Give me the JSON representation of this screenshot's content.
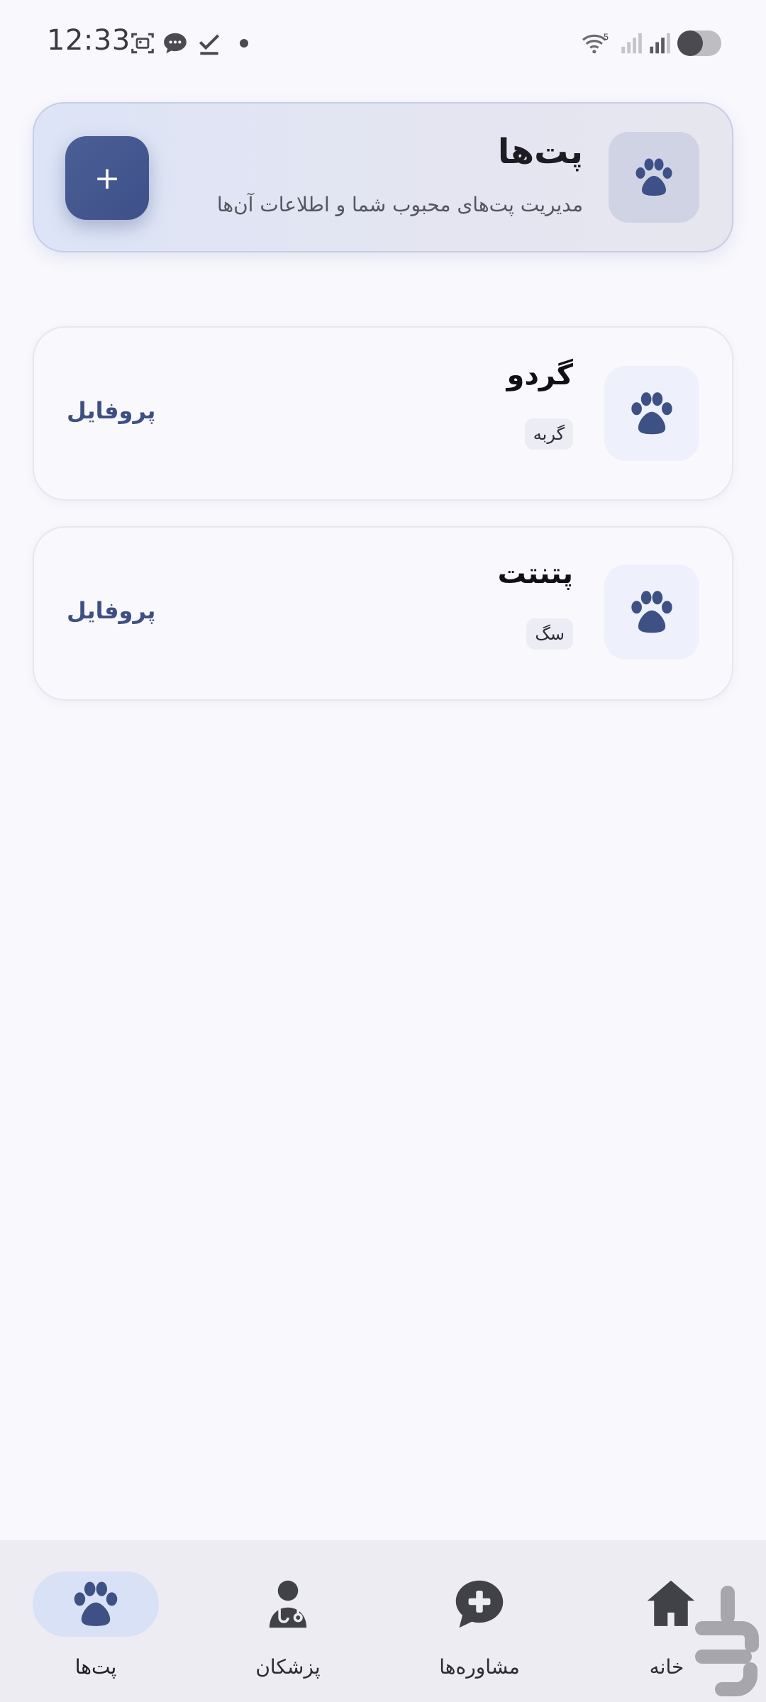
{
  "status_bar": {
    "time": "12:33",
    "left_icons": [
      "screenshot-icon",
      "chat-bubble-icon",
      "checkmark-icon",
      "dot-icon"
    ],
    "right_icons": [
      "wifi-icon",
      "signal-icon",
      "signal-icon",
      "battery-icon"
    ],
    "wifi_label": "5"
  },
  "header": {
    "title": "پت‌ها",
    "subtitle": "مدیریت پت‌های محبوب شما و اطلاعات آن‌ها",
    "add_label": "+",
    "icon": "paw-icon"
  },
  "pets": [
    {
      "name": "گردو",
      "type": "گربه",
      "action": "پروفایل",
      "icon": "paw-icon"
    },
    {
      "name": "پتنتت",
      "type": "سگ",
      "action": "پروفایل",
      "icon": "paw-icon"
    }
  ],
  "nav": {
    "items": [
      {
        "label": "پت‌ها",
        "icon": "paw-icon",
        "active": true
      },
      {
        "label": "پزشکان",
        "icon": "doctor-icon",
        "active": false
      },
      {
        "label": "مشاوره‌ها",
        "icon": "chat-plus-icon",
        "active": false
      },
      {
        "label": "خانه",
        "icon": "home-icon",
        "active": false
      }
    ]
  },
  "colors": {
    "accent": "#3e5185",
    "background": "#f8f8fd",
    "nav_active_pill": "#d9e1f7"
  }
}
